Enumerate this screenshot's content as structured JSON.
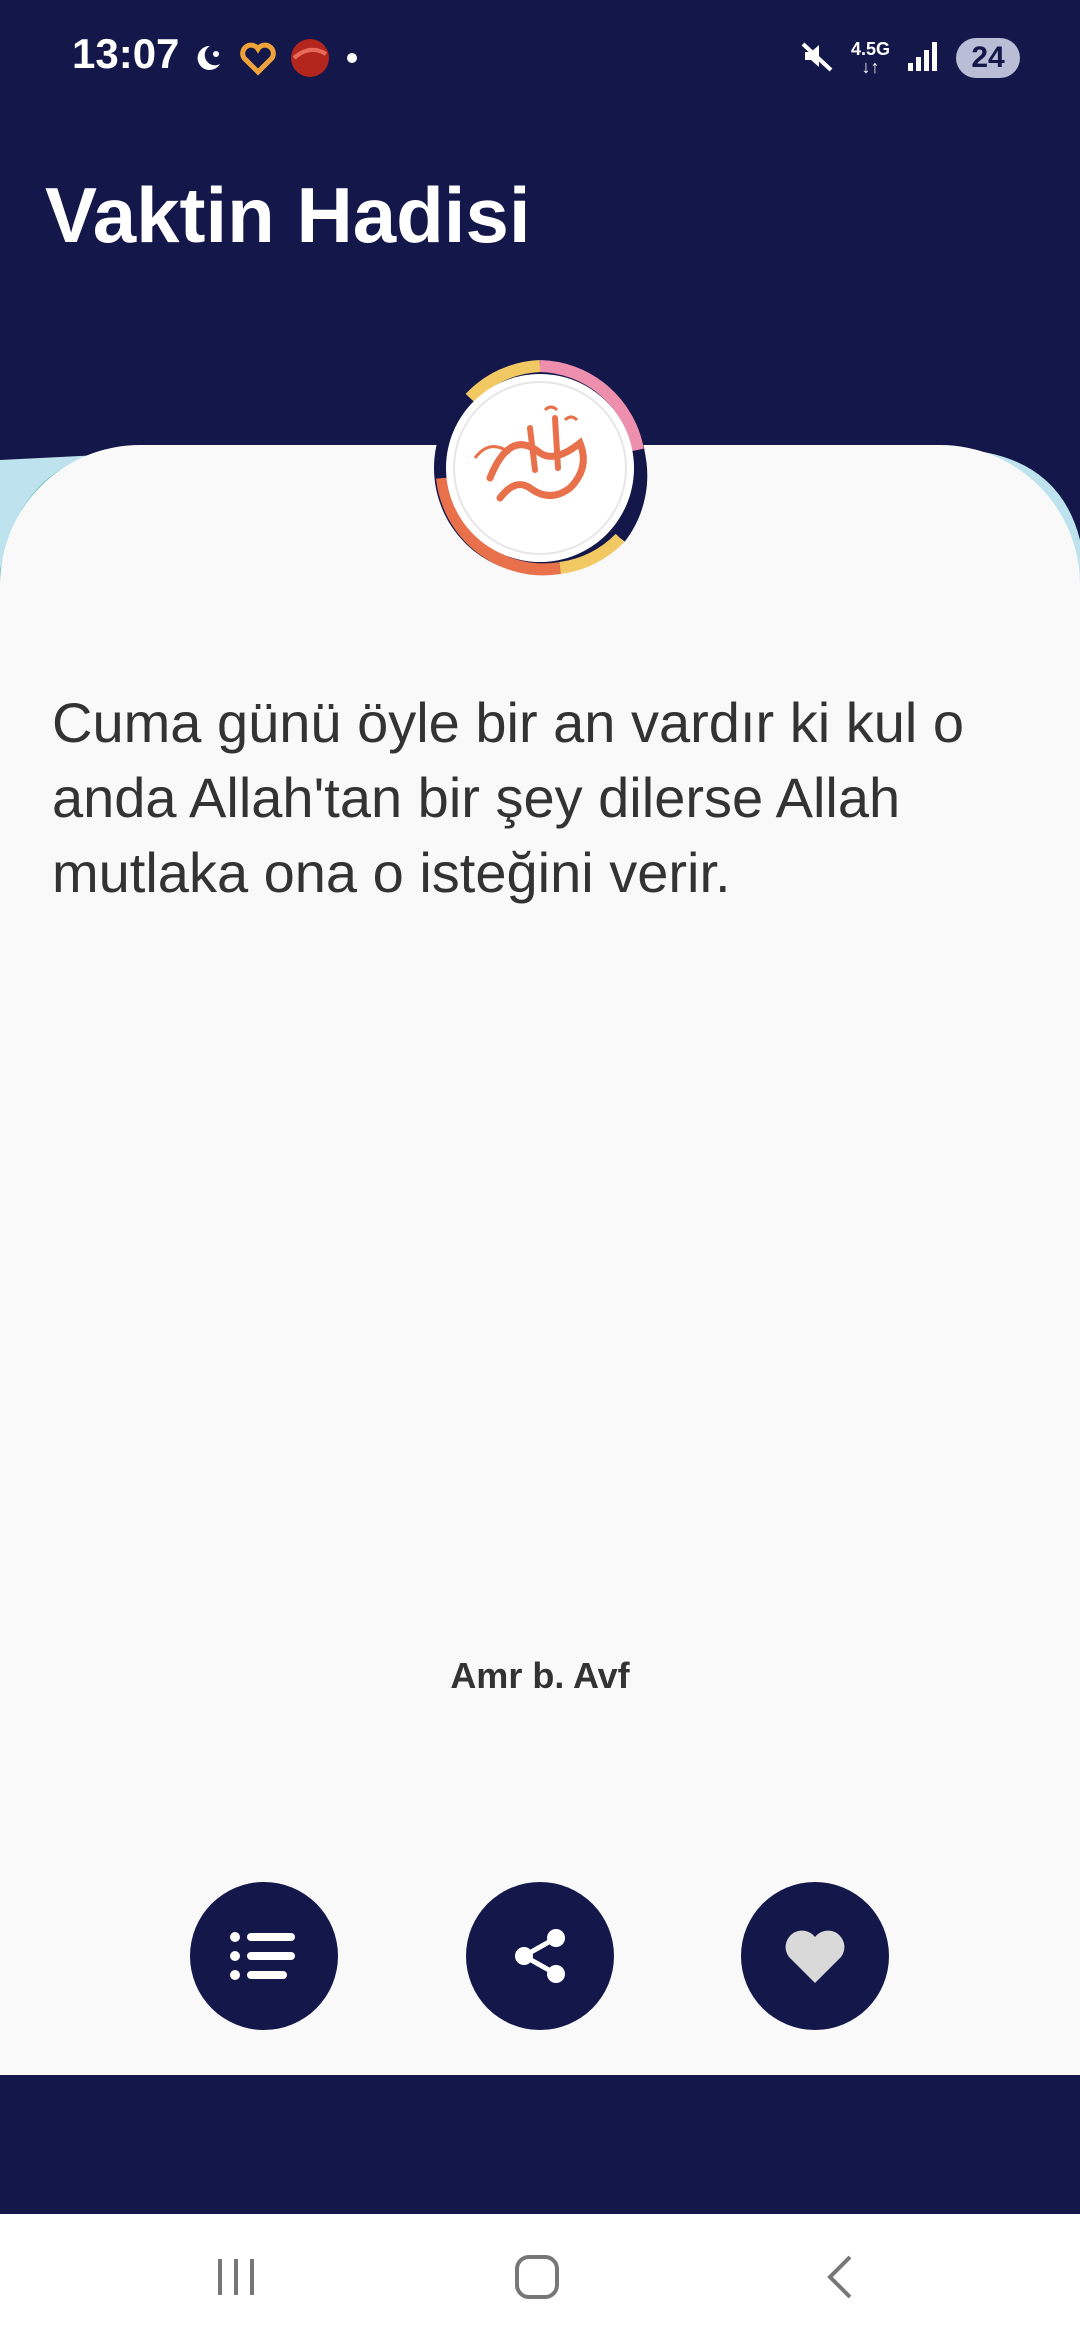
{
  "status_bar": {
    "time": "13:07",
    "network_label": "4.5G",
    "battery": "24",
    "icons": [
      "moon-star-icon",
      "heart-app-icon",
      "ball-app-icon",
      "dot-icon",
      "mute-icon",
      "signal-icon",
      "battery-icon"
    ]
  },
  "header": {
    "title": "Vaktin Hadisi"
  },
  "hadith": {
    "text": "Cuma günü öyle bir an vardır ki kul o anda Allah'tan bir şey dilerse Allah mutlaka ona o isteğini verir.",
    "narrator": "Amr b. Avf"
  },
  "actions": {
    "list_icon": "list-icon",
    "share_icon": "share-icon",
    "favorite_icon": "heart-icon"
  },
  "nav": {
    "icons": [
      "recent-apps-icon",
      "home-icon",
      "back-icon"
    ]
  },
  "colors": {
    "primary": "#13174a",
    "card_bg": "#f9f9f9",
    "accent_orange": "#e8704a",
    "accent_yellow": "#f2c863",
    "accent_pink": "#ee8fae",
    "accent_teal": "#5cbdb2",
    "accent_lightblue": "#bfe3ee"
  }
}
